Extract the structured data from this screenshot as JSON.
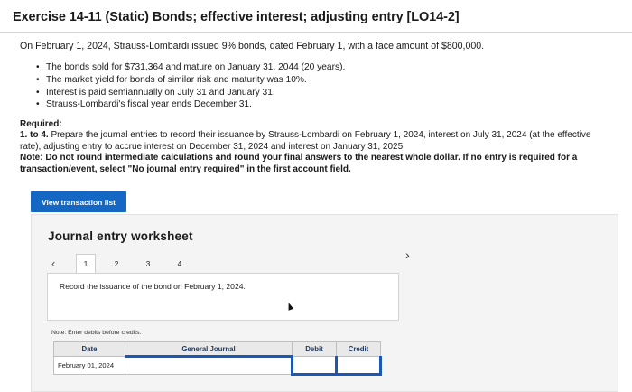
{
  "header": {
    "title": "Exercise 14-11 (Static) Bonds; effective interest; adjusting entry [LO14-2]"
  },
  "problem": {
    "intro": "On February 1, 2024, Strauss-Lombardi issued 9% bonds, dated February 1, with a face amount of $800,000.",
    "bullets": [
      "The bonds sold for $731,364 and mature on January 31, 2044 (20 years).",
      "The market yield for bonds of similar risk and maturity was 10%.",
      "Interest is paid semiannually on July 31 and January 31.",
      "Strauss-Lombardi's fiscal year ends December 31."
    ]
  },
  "required": {
    "heading": "Required:",
    "step_label": "1. to 4.",
    "text": " Prepare the journal entries to record their issuance by Strauss-Lombardi on February 1, 2024, interest on July 31, 2024 (at the effective rate), adjusting entry to accrue interest on December 31, 2024 and interest on January 31, 2025.",
    "note": "Note: Do not round intermediate calculations and round your final answers to the nearest whole dollar. If no entry is required for a transaction/event, select \"No journal entry required\" in the first account field."
  },
  "actions": {
    "view_transaction_list": "View transaction list"
  },
  "worksheet": {
    "title": "Journal entry worksheet",
    "tabs": [
      "1",
      "2",
      "3",
      "4"
    ],
    "active_tab": "1",
    "instruction": "Record the issuance of the bond on February 1, 2024.",
    "note": "Note: Enter debits before credits.",
    "table": {
      "headers": [
        "Date",
        "General Journal",
        "Debit",
        "Credit"
      ],
      "rows": [
        {
          "date": "February 01, 2024",
          "account": "",
          "debit": "",
          "credit": ""
        }
      ]
    }
  },
  "icons": {
    "prev": "chevron-left-icon",
    "next": "chevron-right-icon"
  },
  "colors": {
    "primary_button": "#1468c3",
    "table_header_text": "#1f3a63",
    "input_highlight": "#1a58b3"
  }
}
